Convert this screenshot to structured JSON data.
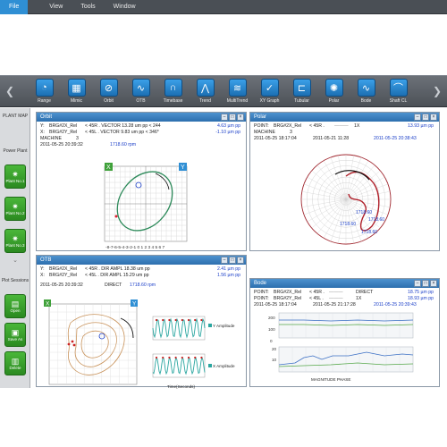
{
  "menu": {
    "items": [
      "File",
      "View",
      "Tools",
      "Window"
    ]
  },
  "toolbar": {
    "items": [
      {
        "label": "Range",
        "icon": "range-icon"
      },
      {
        "label": "Mimic",
        "icon": "mimic-icon"
      },
      {
        "label": "Orbit",
        "icon": "orbit-icon"
      },
      {
        "label": "OTB",
        "icon": "otb-icon"
      },
      {
        "label": "Timebase",
        "icon": "timebase-icon"
      },
      {
        "label": "Trend",
        "icon": "trend-icon"
      },
      {
        "label": "MultiTrend",
        "icon": "multitrend-icon"
      },
      {
        "label": "XY Graph",
        "icon": "xy-graph-icon"
      },
      {
        "label": "Tubular",
        "icon": "tubular-icon"
      },
      {
        "label": "Polar",
        "icon": "polar-icon"
      },
      {
        "label": "Bode",
        "icon": "bode-icon"
      },
      {
        "label": "Shaft CL",
        "icon": "shaft-cl-icon"
      }
    ]
  },
  "sidebar": {
    "plant_map": "PLANT MAP",
    "power_plant": "Power Plant",
    "plants": [
      "Plant No.1",
      "Plant No.2",
      "Plant No.3"
    ],
    "plot_sessions": "Plot Sessions",
    "actions": [
      "Open",
      "Save As",
      "Delete"
    ]
  },
  "orbit": {
    "title": "Orbit",
    "y_label": "Y:",
    "y_name": "BRG#2X_Rel",
    "y_desc": "< 45R . VECTOR 13.28 um pp < 244",
    "y_value": "4.63 µm pp",
    "x_label": "X:",
    "x_name": "BRG#2Y_Rel",
    "x_desc": "< 45L . VECTOR 9.83 um pp < 346*",
    "x_value": "-1.10 µm pp",
    "machine": "MACHINE",
    "machine_no": "3",
    "timestamp": "2011-05-25 20:39:32",
    "rpm": "1718.60 rpm",
    "x_ticks": "-8-7-6-5-4-3-2-1 0 1 2 3 4 5 6 7",
    "axis_x": "X",
    "axis_y": "Y"
  },
  "polar": {
    "title": "Polar",
    "point": "POINT:",
    "point_name": "BRG#2X_Rel",
    "point_desc": "< 45R .",
    "legend": "1X",
    "value": "13.93 µm pp",
    "machine": "MACHINE",
    "machine_no": "3",
    "t1": "2011-05-25 18:17:04",
    "t2": "2011-05-21 11:28",
    "t3": "2011-05-25 20:38:43",
    "rpm_labels": [
      "1718.60",
      "1718.60",
      "1718.60",
      "1718.60"
    ]
  },
  "otb": {
    "title": "OTB",
    "y_label": "Y:",
    "y_name": "BRG#2X_Rel",
    "y_desc": "< 45R . DIR AMPL 18.38 um pp",
    "y_value": "2.41 µm pp",
    "x_label": "X:",
    "x_name": "BRG#2Y_Rel",
    "x_desc": "< 45L . DIR AMPL 15.29 um pp",
    "x_value": "1.56 µm pp",
    "timestamp": "2011-05-25 20:39:32",
    "mode": "DIRECT",
    "rpm": "1718.60 rpm",
    "y_amp": "Y Amplitude",
    "x_amp": "X Amplitude",
    "time_axis": "Time(Seconds)",
    "axis_x": "X",
    "axis_y": "Y"
  },
  "bode": {
    "title": "Bode",
    "p1_label": "POINT:",
    "p1_name": "BRG#2X_Rel",
    "p1_desc": "< 45R .",
    "p1_mode": "DIRECT",
    "p1_value": "18.75 µm pp",
    "p2_label": "POINT:",
    "p2_name": "BRG#2Y_Rel",
    "p2_desc": "< 45L .",
    "p2_mode": "1X",
    "p2_value": "18.93 µm pp",
    "t1": "2011-05-25 18:17:04",
    "t2": "2011-05-25 21:17:28",
    "t3": "2011-05-25 20:39:43",
    "footer": "MAGNITUDE PHASE"
  },
  "colors": {
    "accent": "#2f8fd4",
    "panel_head": "#3a7fc0",
    "green_btn": "#3a9f2e",
    "orbit": "#2d8a5a",
    "polar_red": "#b0202a",
    "value_blue": "#1a3ec8"
  }
}
